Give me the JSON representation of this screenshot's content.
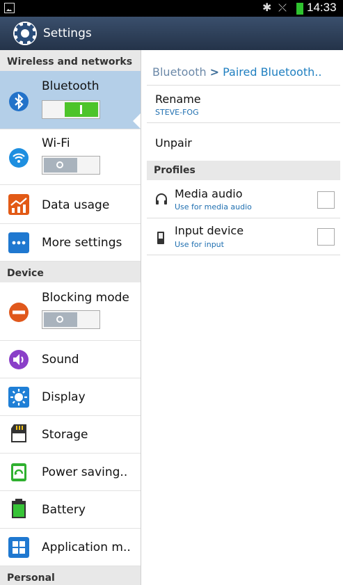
{
  "status_bar": {
    "time": "14:33"
  },
  "header": {
    "title": "Settings"
  },
  "sidebar": {
    "sections": [
      {
        "title": "Wireless and networks",
        "items": [
          {
            "label": "Bluetooth",
            "toggle": "on",
            "selected": true
          },
          {
            "label": "Wi-Fi",
            "toggle": "off"
          },
          {
            "label": "Data usage"
          },
          {
            "label": "More settings"
          }
        ]
      },
      {
        "title": "Device",
        "items": [
          {
            "label": "Blocking mode",
            "toggle": "off"
          },
          {
            "label": "Sound"
          },
          {
            "label": "Display"
          },
          {
            "label": "Storage"
          },
          {
            "label": "Power saving.."
          },
          {
            "label": "Battery"
          },
          {
            "label": "Application m.."
          }
        ]
      },
      {
        "title": "Personal",
        "items": []
      }
    ]
  },
  "detail": {
    "breadcrumb": {
      "parent": "Bluetooth",
      "separator": ">",
      "current": "Paired Bluetooth.."
    },
    "rename": {
      "title": "Rename",
      "value": "STEVE-FOG"
    },
    "unpair": "Unpair",
    "profiles_header": "Profiles",
    "profiles": [
      {
        "title": "Media audio",
        "subtitle": "Use for media audio",
        "icon": "headphones-icon",
        "checked": false
      },
      {
        "title": "Input device",
        "subtitle": "Use for input",
        "icon": "input-device-icon",
        "checked": false
      }
    ]
  },
  "colors": {
    "title_bar": "#2d3f59",
    "selected_item": "#b4cfe8",
    "toggle_on": "#4dc42a",
    "accent_blue": "#1f7fc0"
  }
}
